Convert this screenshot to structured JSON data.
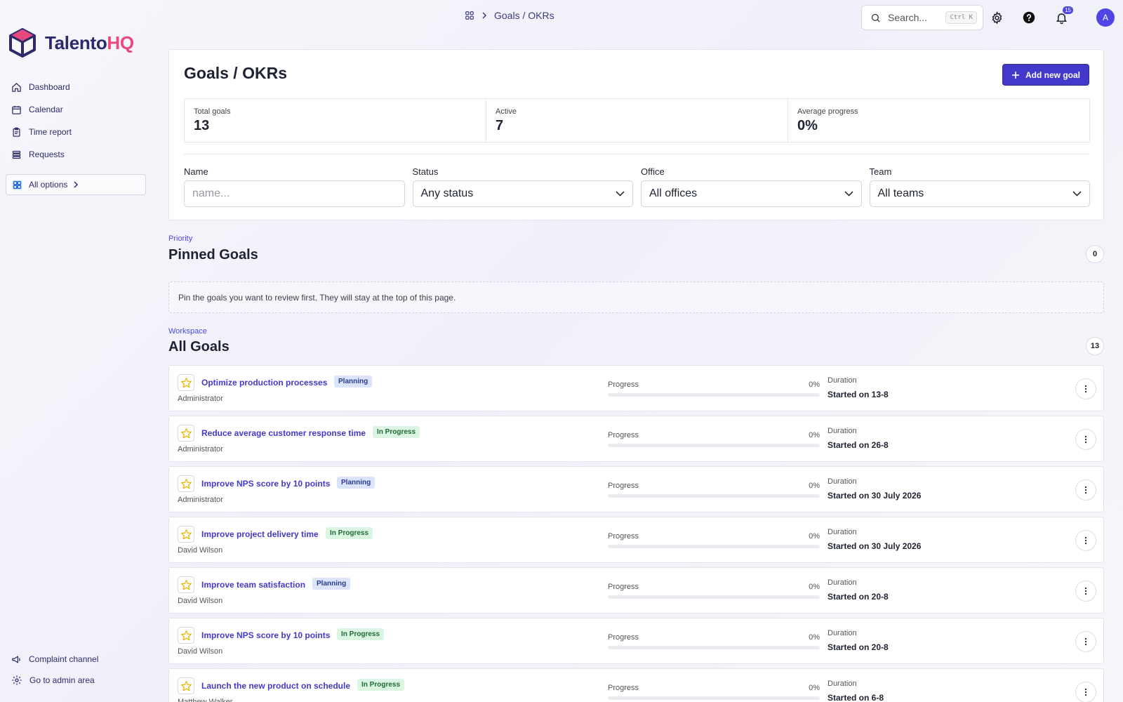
{
  "brand": {
    "name_part1": "Talento",
    "name_part2": "HQ",
    "primary_color": "#2d2a6b",
    "accent_color": "#e84a7f"
  },
  "sidebar": {
    "items": [
      {
        "label": "Dashboard",
        "icon": "home-icon"
      },
      {
        "label": "Calendar",
        "icon": "calendar-icon"
      },
      {
        "label": "Time report",
        "icon": "clipboard-icon"
      },
      {
        "label": "Requests",
        "icon": "list-icon"
      }
    ],
    "all_options_label": "All options",
    "bottom_items": [
      {
        "label": "Complaint channel",
        "icon": "megaphone-icon"
      },
      {
        "label": "Go to admin area",
        "icon": "gear-icon"
      }
    ]
  },
  "topbar": {
    "breadcrumb": "Goals / OKRs",
    "search_placeholder": "Search...",
    "search_shortcut": "Ctrl K",
    "notification_count": "15",
    "avatar_initial": "A"
  },
  "summary": {
    "title": "Goals / OKRs",
    "add_button_label": "Add new goal",
    "stats": [
      {
        "label": "Total goals",
        "value": "13"
      },
      {
        "label": "Active",
        "value": "7"
      },
      {
        "label": "Average progress",
        "value": "0%"
      }
    ],
    "filters": {
      "name": {
        "label": "Name",
        "placeholder": "name..."
      },
      "status": {
        "label": "Status",
        "value": "Any status"
      },
      "office": {
        "label": "Office",
        "value": "All offices"
      },
      "team": {
        "label": "Team",
        "value": "All teams"
      }
    }
  },
  "pinned": {
    "eyebrow": "Priority",
    "title": "Pinned Goals",
    "count": "0",
    "empty_text": "Pin the goals you want to review first. They will stay at the top of this page."
  },
  "all_goals": {
    "eyebrow": "Workspace",
    "title": "All Goals",
    "count": "13",
    "progress_label": "Progress",
    "duration_label": "Duration",
    "items": [
      {
        "name": "Optimize production processes",
        "status": "Planning",
        "owner": "Administrator",
        "progress": 0,
        "progress_text": "0%",
        "duration": "Started on 13-8"
      },
      {
        "name": "Reduce average customer response time",
        "status": "In Progress",
        "owner": "Administrator",
        "progress": 0,
        "progress_text": "0%",
        "duration": "Started on 26-8"
      },
      {
        "name": "Improve NPS score by 10 points",
        "status": "Planning",
        "owner": "Administrator",
        "progress": 0,
        "progress_text": "0%",
        "duration": "Started on 30 July 2026"
      },
      {
        "name": "Improve project delivery time",
        "status": "In Progress",
        "owner": "David Wilson",
        "progress": 0,
        "progress_text": "0%",
        "duration": "Started on 30 July 2026"
      },
      {
        "name": "Improve team satisfaction",
        "status": "Planning",
        "owner": "David Wilson",
        "progress": 0,
        "progress_text": "0%",
        "duration": "Started on 20-8"
      },
      {
        "name": "Improve NPS score by 10 points",
        "status": "In Progress",
        "owner": "David Wilson",
        "progress": 0,
        "progress_text": "0%",
        "duration": "Started on 20-8"
      },
      {
        "name": "Launch the new product on schedule",
        "status": "In Progress",
        "owner": "Matthew Walker",
        "progress": 0,
        "progress_text": "0%",
        "duration": "Started on 6-8"
      }
    ]
  }
}
